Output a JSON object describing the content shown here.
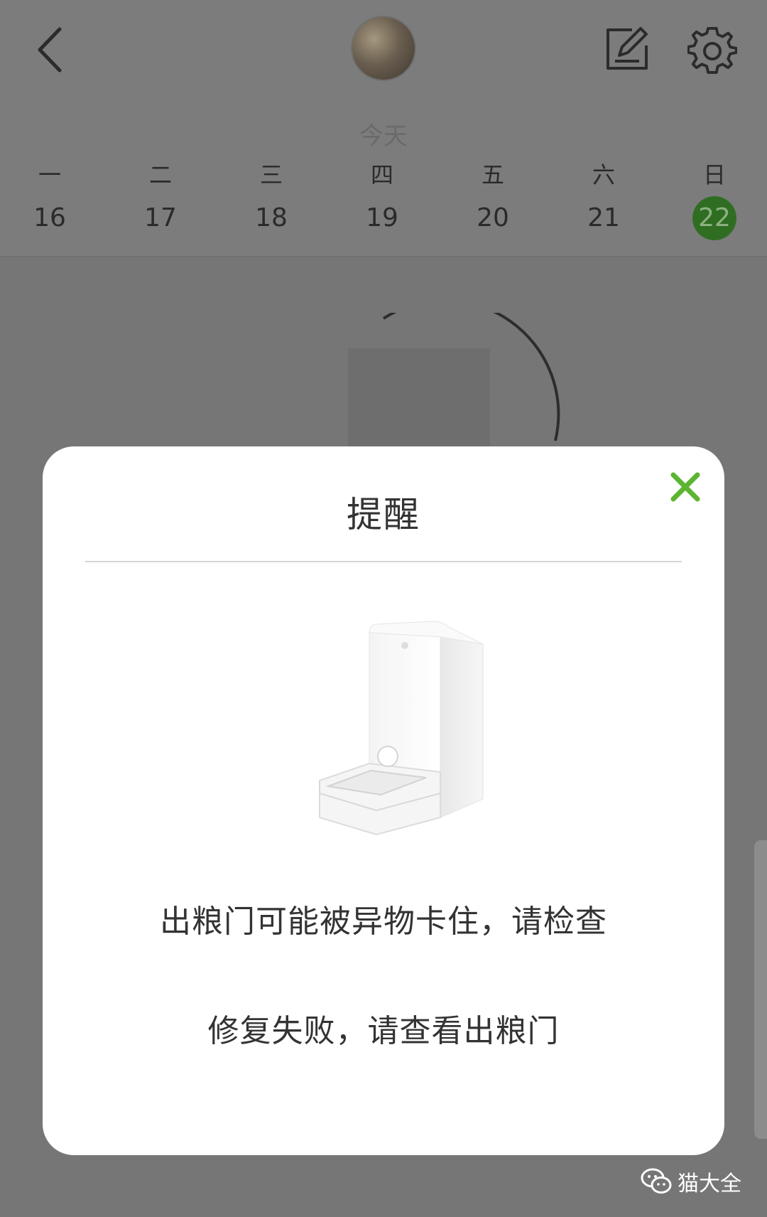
{
  "header": {
    "today_label": "今天",
    "week": [
      {
        "weekday": "一",
        "date": "16",
        "selected": false
      },
      {
        "weekday": "二",
        "date": "17",
        "selected": false
      },
      {
        "weekday": "三",
        "date": "18",
        "selected": false
      },
      {
        "weekday": "四",
        "date": "19",
        "selected": false
      },
      {
        "weekday": "五",
        "date": "20",
        "selected": false
      },
      {
        "weekday": "六",
        "date": "21",
        "selected": false
      },
      {
        "weekday": "日",
        "date": "22",
        "selected": true
      }
    ],
    "icons": {
      "back": "chevron-left-icon",
      "edit": "edit-icon",
      "settings": "gear-icon"
    }
  },
  "modal": {
    "title": "提醒",
    "close_icon": "close-icon",
    "accent_color": "#5cb531",
    "message_1": "出粮门可能被异物卡住，请检查",
    "message_2": "修复失败，请查看出粮门"
  },
  "watermark": {
    "icon": "wechat-icon",
    "text": "猫大全"
  },
  "colors": {
    "overlay": "#767676",
    "selected_day": "#2f6e22"
  }
}
